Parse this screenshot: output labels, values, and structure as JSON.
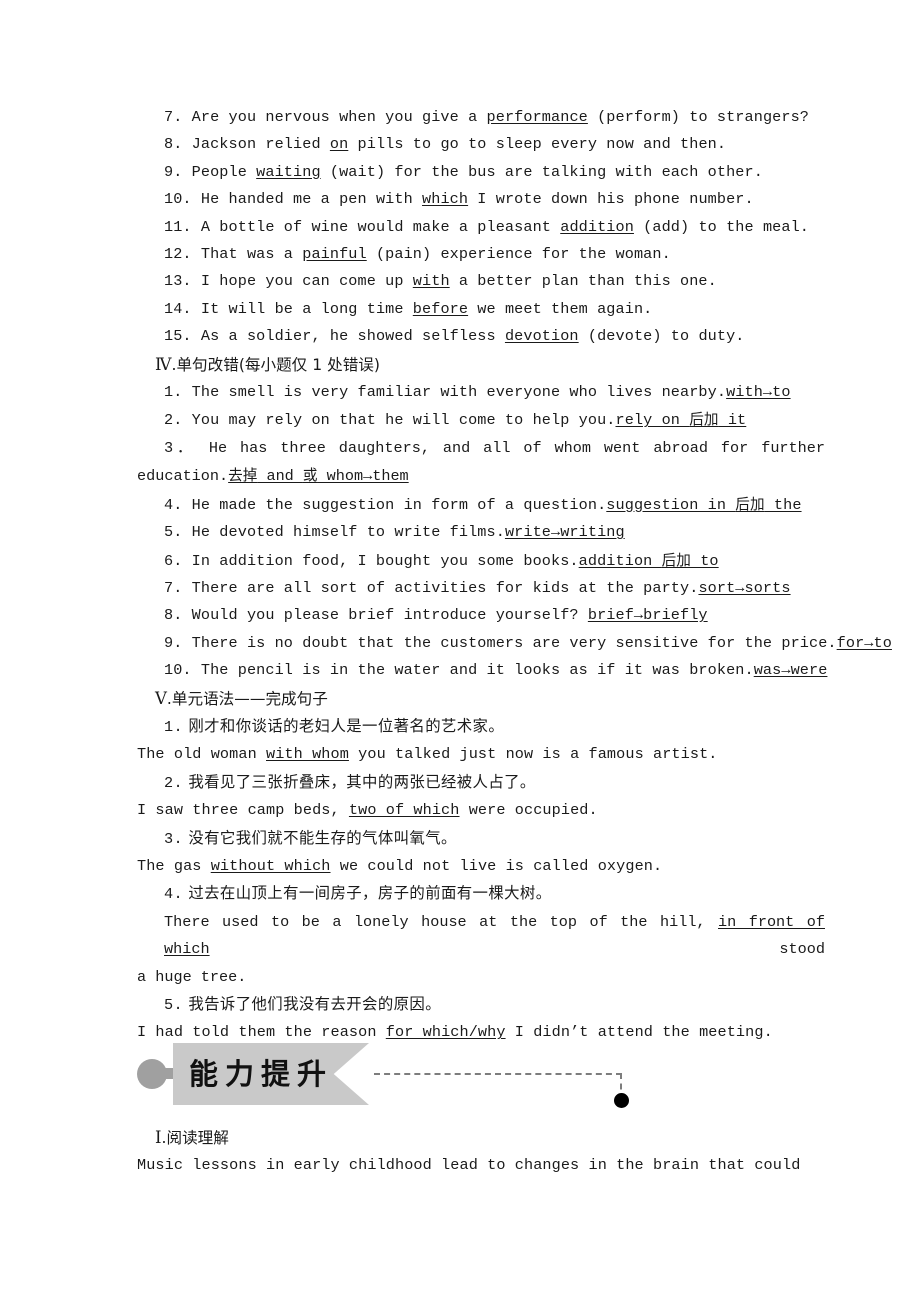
{
  "section_three_items": [
    {
      "n": "7.",
      "pre": "Are you nervous when you give a ",
      "ul": "performance",
      "post": " (perform) to strangers?"
    },
    {
      "n": "8.",
      "pre": "Jackson relied ",
      "ul": "on",
      "post": " pills to go to sleep every now and then."
    },
    {
      "n": "9.",
      "pre": "People ",
      "ul": "waiting",
      "post": " (wait) for the bus are talking with each other."
    },
    {
      "n": "10.",
      "pre": "He handed me a pen with ",
      "ul": "which",
      "post": " I wrote down his phone number."
    },
    {
      "n": "11.",
      "pre": "A bottle of wine would make a pleasant ",
      "ul": "addition",
      "post": " (add) to the meal."
    },
    {
      "n": "12.",
      "pre": "That was a ",
      "ul": "painful",
      "post": " (pain)  experience for the woman."
    },
    {
      "n": "13.",
      "pre": "I hope you can come up ",
      "ul": "with",
      "post": " a better plan than this one."
    },
    {
      "n": "14.",
      "pre": "It will be a long time ",
      "ul": "before",
      "post": " we meet them again."
    },
    {
      "n": "15.",
      "pre": "As a soldier, he showed selfless ",
      "ul": "devotion",
      "post": " (devote) to duty."
    }
  ],
  "section_four": {
    "heading_numeral": "Ⅳ",
    "heading_text": ".单句改错(每小题仅 1 处错误)",
    "item1": {
      "n": "1.",
      "sentence": "The smell is very familiar with everyone who lives nearby.",
      "answer": "with→to"
    },
    "item2": {
      "n": "2.",
      "sentence": "You may rely on that he will come to help you.",
      "answer_a": "rely on ",
      "answer_cn": "后加",
      "answer_b": " it"
    },
    "item3": {
      "n": "3",
      "line_a": "． He has three daughters, and all of whom went abroad for further",
      "line_b_pre": "education.",
      "line_b_cn1": "去掉",
      "line_b_mid": " and ",
      "line_b_cn2": "或",
      "line_b_end": " whom→them"
    },
    "item4": {
      "n": "4.",
      "sentence": "He made the suggestion in form of a question.",
      "answer_a": "suggestion in ",
      "answer_cn": "后加",
      "answer_b": " the"
    },
    "item5": {
      "n": "5.",
      "sentence": "He devoted himself to write films.",
      "answer": "write→writing"
    },
    "item6": {
      "n": "6.",
      "sentence": "In addition food, I bought you some books.",
      "answer_a": "addition ",
      "answer_cn": "后加",
      "answer_b": " to"
    },
    "item7": {
      "n": "7.",
      "sentence": "There are all sort of activities for kids at the party.",
      "answer": "sort→sorts"
    },
    "item8": {
      "n": "8.",
      "sentence": "Would you please brief introduce yourself? ",
      "answer": "brief→briefly"
    },
    "item9": {
      "n": "9.",
      "sentence": "There is no doubt that the customers are very sensitive for the price.",
      "answer": "for→to"
    },
    "item10": {
      "n": "10.",
      "sentence": "The pencil is in the water and it looks as if it was broken.",
      "answer": "was→were"
    }
  },
  "section_five": {
    "heading_numeral": "Ⅴ",
    "heading_text": ".单元语法——完成句子",
    "items": [
      {
        "n": "1.",
        "cn": "刚才和你谈话的老妇人是一位著名的艺术家。",
        "en_pre": "The old woman ",
        "en_ul": "with whom",
        "en_post": " you talked just now is a famous artist."
      },
      {
        "n": "2.",
        "cn": "我看见了三张折叠床，其中的两张已经被人占了。",
        "en_pre": "I saw three camp beds, ",
        "en_ul": "two of which",
        "en_post": " were occupied."
      },
      {
        "n": "3.",
        "cn": "没有它我们就不能生存的气体叫氧气。",
        "en_pre": "The gas ",
        "en_ul": "without which",
        "en_post": " we could not live is called oxygen."
      },
      {
        "n": "4.",
        "cn": "过去在山顶上有一间房子，房子的前面有一棵大树。",
        "en_pre": "There used to be a lonely house at the top of the hill, ",
        "en_ul": "in front of which",
        "en_post": " stood",
        "en_wrap": "a huge tree."
      },
      {
        "n": "5.",
        "cn": "我告诉了他们我没有去开会的原因。",
        "en_pre": "I had told them the reason ",
        "en_ul": "for which/why",
        "en_post": " I didn’t attend the meeting."
      }
    ]
  },
  "banner": {
    "label": "能力提升",
    "ribbon_color": "#c9c9c9",
    "left_dot_color": "#a0a0a0",
    "right_dot_color": "#000000",
    "dash_color": "#7d7d7d"
  },
  "bottom": {
    "heading_numeral": "Ⅰ",
    "heading_text": ".阅读理解",
    "paragraph_line": "Music lessons in early childhood lead to changes in the brain  that  could"
  }
}
